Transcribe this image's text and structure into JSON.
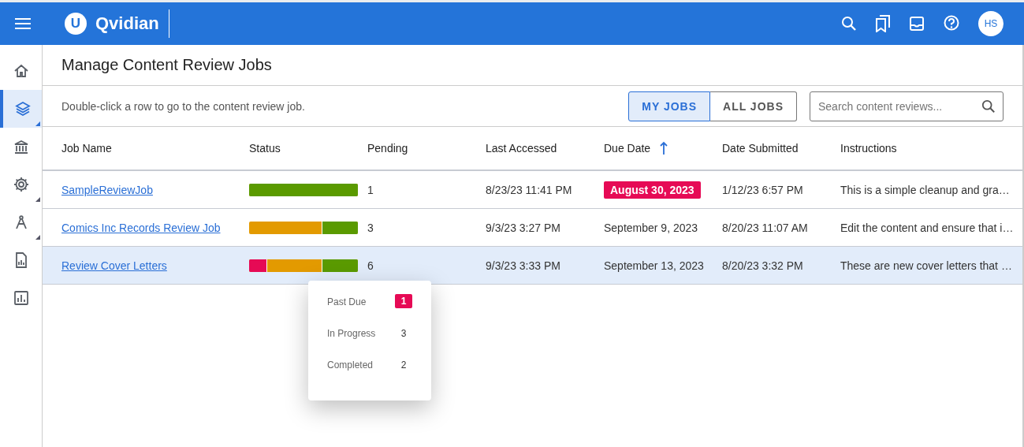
{
  "app_bar": {
    "logo_letter": "U",
    "brand": "Qvidian",
    "avatar": "HS"
  },
  "sidebar": {
    "items": [
      {
        "kind": "home",
        "selected": false,
        "submenu": false
      },
      {
        "kind": "layers",
        "selected": true,
        "submenu": true
      },
      {
        "kind": "bank",
        "selected": false,
        "submenu": false
      },
      {
        "kind": "gear",
        "selected": false,
        "submenu": true
      },
      {
        "kind": "compass",
        "selected": false,
        "submenu": true
      },
      {
        "kind": "report",
        "selected": false,
        "submenu": false
      },
      {
        "kind": "chart",
        "selected": false,
        "submenu": false
      }
    ]
  },
  "page_title": "Manage Content Review Jobs",
  "hint": "Double-click a row to go to the content review job.",
  "toggle": [
    {
      "label": "MY JOBS",
      "selected": true
    },
    {
      "label": "ALL JOBS",
      "selected": false
    }
  ],
  "search": {
    "placeholder": "Search content reviews..."
  },
  "table": {
    "columns": [
      {
        "label": "Job Name",
        "sorted": false
      },
      {
        "label": "Status",
        "sorted": false
      },
      {
        "label": "Pending",
        "sorted": false
      },
      {
        "label": "Last Accessed",
        "sorted": false
      },
      {
        "label": "Due Date",
        "sorted": true
      },
      {
        "label": "Date Submitted",
        "sorted": false
      },
      {
        "label": "Instructions",
        "sorted": false
      }
    ],
    "rows": [
      {
        "name": "SampleReviewJob",
        "status": [
          {
            "kind": "completed",
            "level": 1
          }
        ],
        "pending": "1",
        "last_accessed": "8/23/23 11:41 PM",
        "due_date": "August 30, 2023",
        "overdue": true,
        "submitted": "1/12/23 6:57 PM",
        "instructions": "This is a simple cleanup and gra…",
        "selected": false
      },
      {
        "name": "Comics Inc Records Review Job",
        "status": [
          {
            "kind": "completed",
            "level": 0.333
          }
        ],
        "pending": "3",
        "last_accessed": "9/3/23 3:27 PM",
        "due_date": "September 9, 2023",
        "overdue": false,
        "submitted": "8/20/23 11:07 AM",
        "instructions": "Edit the content and ensure that i…",
        "selected": false
      },
      {
        "name": "Review Cover Letters",
        "status": [
          {
            "kind": "past_due",
            "level": 0.167
          },
          {
            "kind": "completed",
            "level": 0.333
          }
        ],
        "pending": "6",
        "last_accessed": "9/3/23 3:33 PM",
        "due_date": "September 13, 2023",
        "overdue": false,
        "submitted": "8/20/23 3:32 PM",
        "instructions": "These are new cover letters that …",
        "selected": true
      }
    ]
  },
  "tooltip": {
    "items": [
      {
        "label": "Past Due",
        "value": "1",
        "highlight": true
      },
      {
        "label": "In Progress",
        "value": "3",
        "highlight": false
      },
      {
        "label": "Completed",
        "value": "2",
        "highlight": false
      }
    ]
  }
}
